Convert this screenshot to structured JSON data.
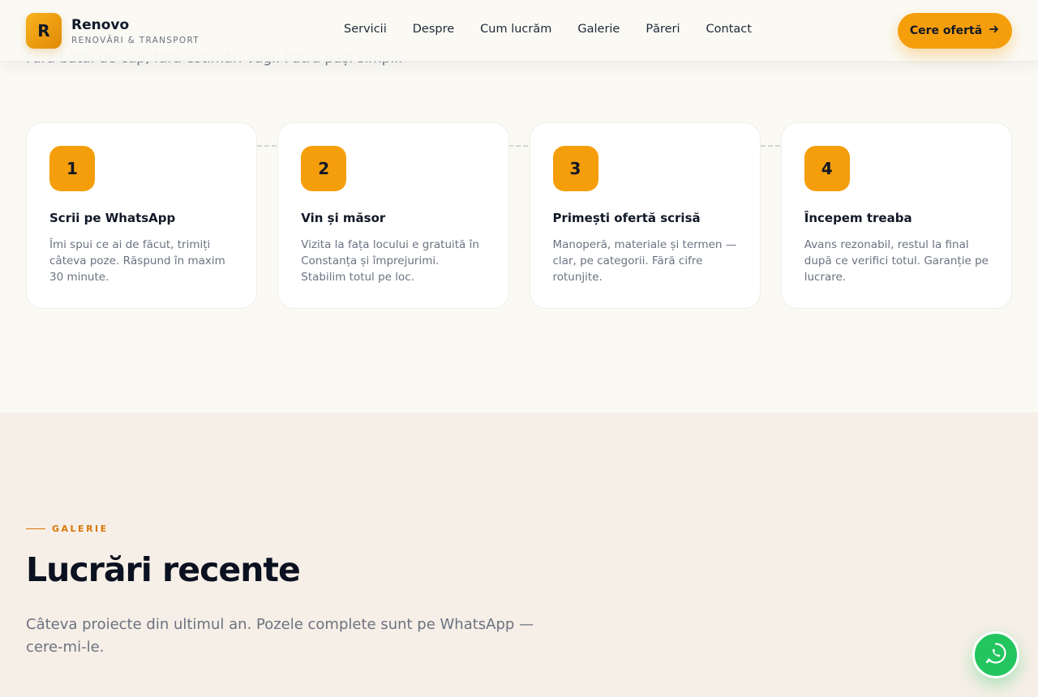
{
  "navbar": {
    "brand_letter": "R",
    "brand_name": "Renovo",
    "brand_tagline": "RENOVĂRI & TRANSPORT",
    "links": [
      "Servicii",
      "Despre",
      "Cum lucrăm",
      "Galerie",
      "Păreri",
      "Contact"
    ],
    "cta_label": "Cere ofertă",
    "cta_icon": "arrow-right-icon"
  },
  "steps": {
    "intro": "Fără bătăi de cap, fără estimări vagi. Patru pași simpli.",
    "items": [
      {
        "number": "1",
        "title": "Scrii pe WhatsApp",
        "desc": "Îmi spui ce ai de făcut, trimiți câteva poze. Răspund în maxim 30 minute."
      },
      {
        "number": "2",
        "title": "Vin și măsor",
        "desc": "Vizita la fața locului e gratuită în Constanța și împrejurimi. Stabilim totul pe loc."
      },
      {
        "number": "3",
        "title": "Primești ofertă scrisă",
        "desc": "Manoperă, materiale și termen — clar, pe categorii. Fără cifre rotunjite."
      },
      {
        "number": "4",
        "title": "Începem treaba",
        "desc": "Avans rezonabil, restul la final după ce verifici totul. Garanție pe lucrare."
      }
    ]
  },
  "gallery": {
    "eyebrow": "GALERIE",
    "title": "Lucrări recente",
    "subtitle": "Câteva proiecte din ultimul an. Pozele complete sunt pe WhatsApp — cere-mi-le."
  },
  "fab": {
    "icon": "whatsapp-icon"
  },
  "colors": {
    "accent": "#f59e0b",
    "whatsapp": "#22c55e",
    "eyebrow": "#d97706"
  }
}
